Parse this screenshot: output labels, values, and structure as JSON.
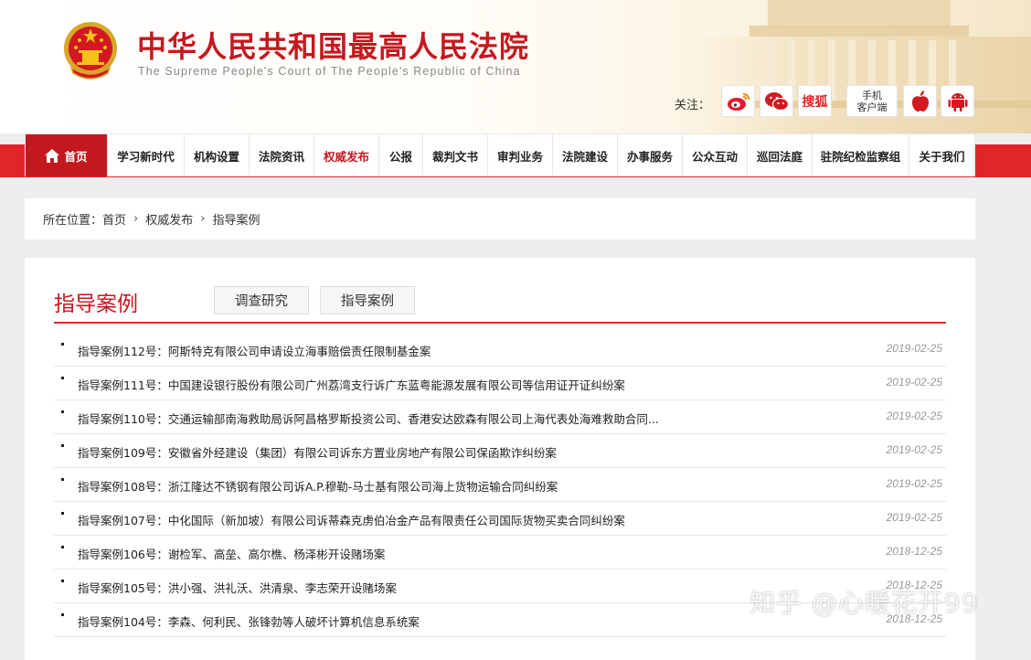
{
  "header": {
    "title": "中华人民共和国最高人民法院",
    "subtitle": "The Supreme People's Court of The People's Republic of China",
    "follow_label": "关注：",
    "social": {
      "weibo": "weibo-icon",
      "wechat": "wechat-icon",
      "sohu_label": "搜狐",
      "mobile_label_1": "手机",
      "mobile_label_2": "客户端",
      "apple": "apple-icon",
      "android": "android-icon"
    }
  },
  "nav": {
    "items": [
      {
        "label": "首页"
      },
      {
        "label": "学习新时代"
      },
      {
        "label": "机构设置"
      },
      {
        "label": "法院资讯"
      },
      {
        "label": "权威发布"
      },
      {
        "label": "公报"
      },
      {
        "label": "裁判文书"
      },
      {
        "label": "审判业务"
      },
      {
        "label": "法院建设"
      },
      {
        "label": "办事服务"
      },
      {
        "label": "公众互动"
      },
      {
        "label": "巡回法庭"
      },
      {
        "label": "驻院纪检监察组"
      },
      {
        "label": "关于我们"
      }
    ]
  },
  "breadcrumb": {
    "prefix": "所在位置：",
    "items": [
      "首页",
      "权威发布",
      "指导案例"
    ]
  },
  "section": {
    "title": "指导案例",
    "tabs": [
      "调查研究",
      "指导案例"
    ]
  },
  "cases": [
    {
      "title": "指导案例112号：阿斯特克有限公司申请设立海事赔偿责任限制基金案",
      "date": "2019-02-25"
    },
    {
      "title": "指导案例111号：中国建设银行股份有限公司广州荔湾支行诉广东蓝粤能源发展有限公司等信用证开证纠纷案",
      "date": "2019-02-25"
    },
    {
      "title": "指导案例110号：交通运输部南海救助局诉阿昌格罗斯投资公司、香港安达欧森有限公司上海代表处海难救助合同...",
      "date": "2019-02-25"
    },
    {
      "title": "指导案例109号：安徽省外经建设（集团）有限公司诉东方置业房地产有限公司保函欺诈纠纷案",
      "date": "2019-02-25"
    },
    {
      "title": "指导案例108号：浙江隆达不锈钢有限公司诉A.P.穆勒-马士基有限公司海上货物运输合同纠纷案",
      "date": "2019-02-25"
    },
    {
      "title": "指导案例107号：中化国际（新加坡）有限公司诉蒂森克虏伯冶金产品有限责任公司国际货物买卖合同纠纷案",
      "date": "2019-02-25"
    },
    {
      "title": "指导案例106号：谢检军、高垒、高尔樵、杨泽彬开设赌场案",
      "date": "2018-12-25"
    },
    {
      "title": "指导案例105号：洪小强、洪礼沃、洪清泉、李志荣开设赌场案",
      "date": "2018-12-25"
    },
    {
      "title": "指导案例104号：李森、何利民、张锋勃等人破坏计算机信息系统案",
      "date": "2018-12-25"
    }
  ],
  "watermark": "知乎 @心暖花开99",
  "colors": {
    "brand_red": "#c4181f",
    "nav_band": "#e1262b",
    "date_gray": "#999999"
  }
}
